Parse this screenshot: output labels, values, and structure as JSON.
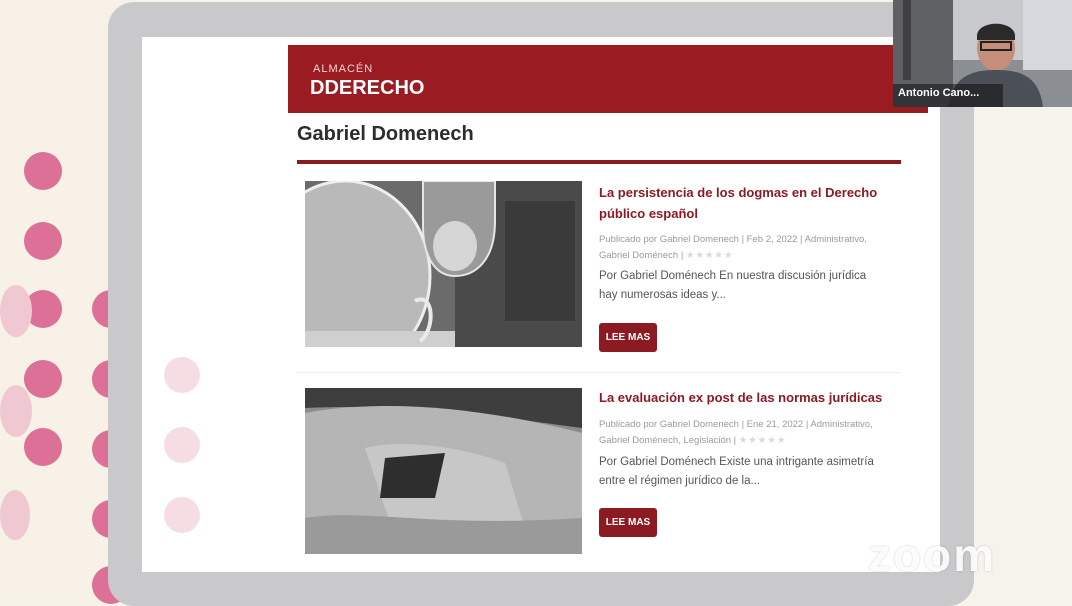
{
  "site": {
    "logo_top": "ALMACÉN",
    "logo_main": "DERECHO",
    "author": "Gabriel Domenech"
  },
  "posts": [
    {
      "title": "La persistencia de los dogmas en el Derecho público español",
      "meta": "Publicado por Gabriel Domenech | Feb 2, 2022 | Administrativo, Gabriel Doménech |",
      "excerpt": "Por Gabriel Doménech   En nuestra discusión jurídica hay numerosas ideas y...",
      "button": "LEE MAS",
      "rating": "★★★★★"
    },
    {
      "title": "La evaluación ex post de las normas jurídicas",
      "meta": "Publicado por Gabriel Domenech | Ene 21, 2022 | Administrativo, Gabriel Doménech, Legislación |",
      "excerpt": "Por Gabriel Doménech   Existe una intrigante asimetría entre el régimen jurídico de la...",
      "button": "LEE MAS",
      "rating": "★★★★★"
    }
  ],
  "video_tile": {
    "name": "Antonio Cano..."
  },
  "watermark": "zoom",
  "colors": {
    "brand": "#9b1b22",
    "accent_dots": "#d9688a"
  }
}
